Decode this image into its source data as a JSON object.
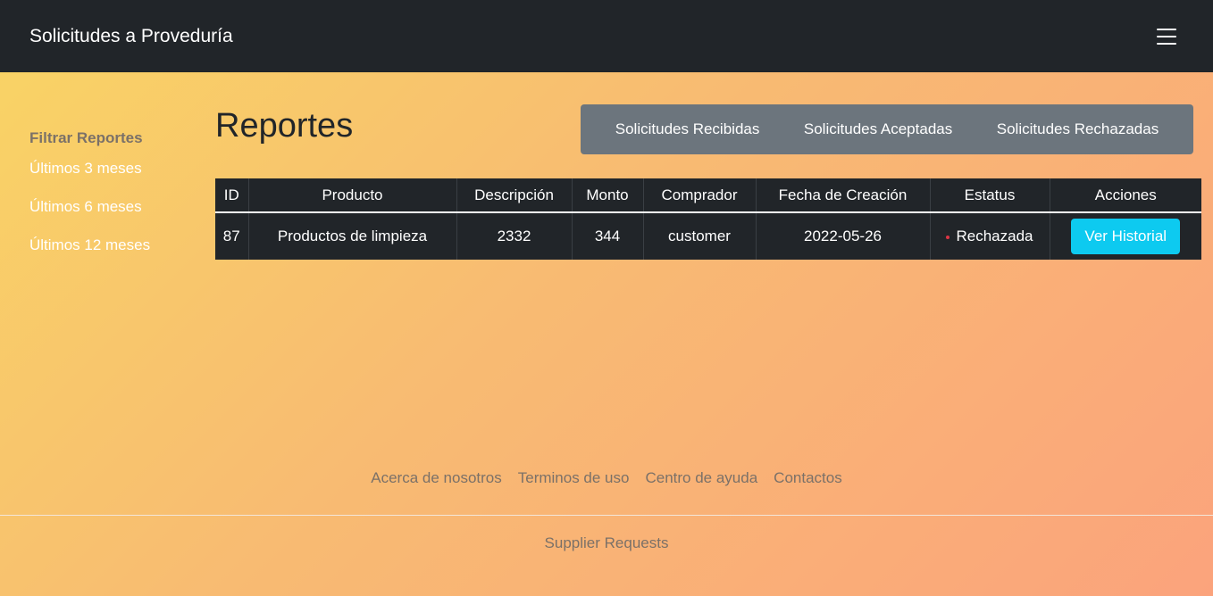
{
  "navbar": {
    "brand": "Solicitudes a Proveduría",
    "menu_icon": "hamburger-menu-icon"
  },
  "sidebar": {
    "heading": "Filtrar Reportes",
    "items": [
      {
        "label": "Últimos 3 meses"
      },
      {
        "label": "Últimos 6 meses"
      },
      {
        "label": "Últimos 12 meses"
      }
    ]
  },
  "main": {
    "title": "Reportes",
    "tabs": [
      {
        "label": "Solicitudes Recibidas"
      },
      {
        "label": "Solicitudes Aceptadas"
      },
      {
        "label": "Solicitudes Rechazadas"
      }
    ],
    "table": {
      "headers": [
        "ID",
        "Producto",
        "Descripción",
        "Monto",
        "Comprador",
        "Fecha de Creación",
        "Estatus",
        "Acciones"
      ],
      "rows": [
        {
          "id": "87",
          "producto": "Productos de limpieza",
          "descripcion": "2332",
          "monto": "344",
          "comprador": "customer",
          "fecha": "2022-05-26",
          "estatus": "Rechazada",
          "status_color": "#dc3545",
          "action_label": "Ver Historial"
        }
      ]
    }
  },
  "footer": {
    "links": [
      {
        "label": "Acerca de nosotros"
      },
      {
        "label": "Terminos de uso"
      },
      {
        "label": "Centro de ayuda"
      },
      {
        "label": "Contactos"
      }
    ],
    "copyright": "Supplier Requests"
  },
  "colors": {
    "navbar_bg": "#212529",
    "tabs_bg": "#6c757d",
    "action_button": "#0dcaf0",
    "gradient_start": "#f9d564",
    "gradient_end": "#fba37c"
  }
}
